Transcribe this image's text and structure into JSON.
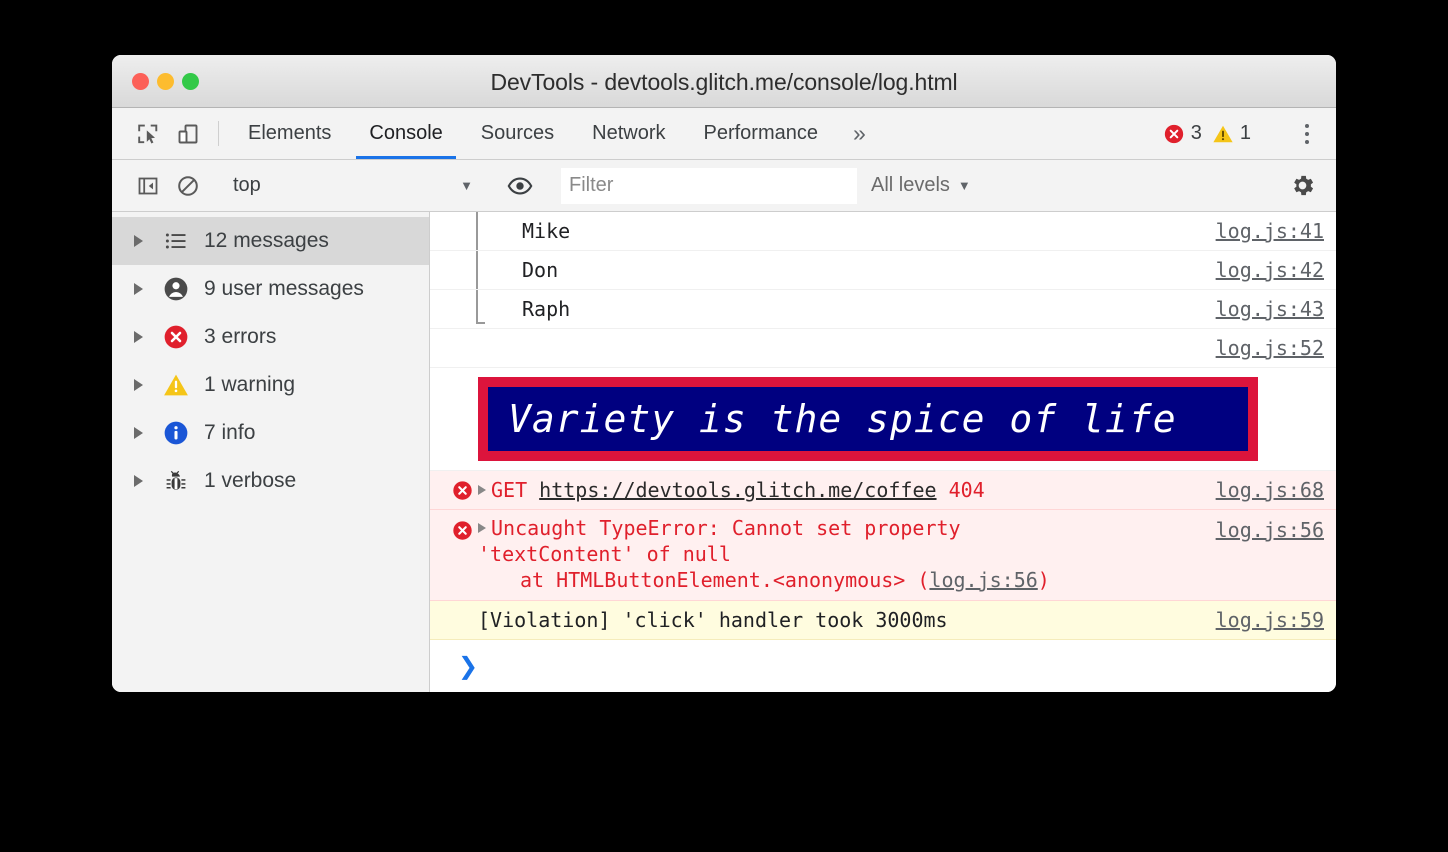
{
  "window": {
    "title": "DevTools - devtools.glitch.me/console/log.html",
    "traffic_lights": [
      "close",
      "minimize",
      "maximize"
    ]
  },
  "tabbar": {
    "inspect_icon": "inspect-element-icon",
    "device_icon": "device-toolbar-icon",
    "tabs": [
      {
        "label": "Elements",
        "active": false
      },
      {
        "label": "Console",
        "active": true
      },
      {
        "label": "Sources",
        "active": false
      },
      {
        "label": "Network",
        "active": false
      },
      {
        "label": "Performance",
        "active": false
      }
    ],
    "more_tabs_label": "»",
    "error_count": "3",
    "warning_count": "1",
    "menu_icon": "vertical-dots-icon"
  },
  "filterbar": {
    "sidebar_toggle_icon": "show-console-sidebar-icon",
    "clear_icon": "clear-console-icon",
    "context": "top",
    "context_caret": "▼",
    "eye_icon": "live-expression-eye-icon",
    "filter_placeholder": "Filter",
    "filter_value": "",
    "levels": "All levels",
    "levels_caret": "▼",
    "settings_icon": "gear-icon"
  },
  "sidebar": {
    "items": [
      {
        "label": "12 messages",
        "icon": "list-icon",
        "selected": true
      },
      {
        "label": "9 user messages",
        "icon": "user-icon",
        "selected": false
      },
      {
        "label": "3 errors",
        "icon": "error-icon",
        "selected": false
      },
      {
        "label": "1 warning",
        "icon": "warning-icon",
        "selected": false
      },
      {
        "label": "7 info",
        "icon": "info-icon",
        "selected": false
      },
      {
        "label": "1 verbose",
        "icon": "bug-icon",
        "selected": false
      }
    ]
  },
  "console": {
    "messages": [
      {
        "text": "Mike",
        "source": "log.js:41"
      },
      {
        "text": "Don",
        "source": "log.js:42"
      },
      {
        "text": "Raph",
        "source": "log.js:43"
      },
      {
        "text": "",
        "source": "log.js:52"
      }
    ],
    "styled_message": {
      "text": "Variety is the spice of life",
      "background_color": "#000080",
      "border_color": "#dc143c",
      "text_color": "#ffffff"
    },
    "network_error": {
      "method": "GET",
      "url": "https://devtools.glitch.me/coffee",
      "status": "404",
      "source": "log.js:68"
    },
    "type_error": {
      "line1": "Uncaught TypeError: Cannot set property",
      "line2": "'textContent' of null",
      "line3_prefix": "at HTMLButtonElement.<anonymous> (",
      "line3_link": "log.js:56",
      "line3_suffix": ")",
      "source": "log.js:56"
    },
    "violation": {
      "text": "[Violation] 'click' handler took 3000ms",
      "source": "log.js:59"
    },
    "prompt_chevron": "❯"
  },
  "colors": {
    "accent_blue": "#1a73e8",
    "error_red": "#e0202c",
    "warning_yellow": "#f5c518",
    "info_blue": "#1a73e8",
    "error_row_bg": "#fff0f0",
    "warning_row_bg": "#fffcdf"
  }
}
